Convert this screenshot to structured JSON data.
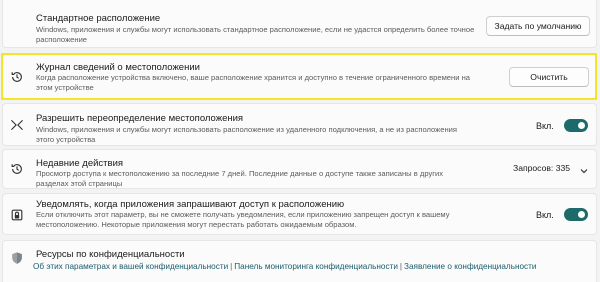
{
  "default_location": {
    "title": "Стандартное расположение",
    "description": "Windows, приложения и службы могут использовать стандартное расположение, если не удастся определить более точное расположение",
    "button_label": "Задать по умолчанию"
  },
  "location_history": {
    "title": "Журнал сведений о местоположении",
    "description": "Когда расположение устройства включено, ваше расположение хранится и доступно в течение ограниченного времени на этом устройстве",
    "button_label": "Очистить",
    "highlight_color": "#f2e52b"
  },
  "location_override": {
    "title": "Разрешить переопределение местоположения",
    "description": "Windows, приложения и службы могут использовать расположение из удаленного подключения, а не из расположения этого устройства",
    "toggle_label": "Вкл.",
    "toggle_on": true
  },
  "recent_activity": {
    "title": "Недавние действия",
    "description": "Просмотр доступа к местоположению за последние 7 дней. Последние данные о доступе также записаны в других разделах этой страницы",
    "requests_label": "Запросов: 335"
  },
  "notify_apps": {
    "title": "Уведомлять, когда приложения запрашивают доступ к расположению",
    "description": "Если отключить этот параметр, вы не сможете получать уведомления, если приложению запрещен доступ к вашему местоположению. Некоторые приложения могут перестать работать ожидаемым образом.",
    "toggle_label": "Вкл.",
    "toggle_on": true
  },
  "privacy_resources": {
    "title": "Ресурсы по конфиденциальности",
    "links": [
      "Об этих параметрах и вашей конфиденциальности",
      "Панель мониторинга конфиденциальности",
      "Заявление о конфиденциальности"
    ],
    "separator": "|"
  },
  "colors": {
    "accent": "#1d6a6a",
    "link": "#1a5c6b",
    "page_background": "#f3f3f3"
  }
}
